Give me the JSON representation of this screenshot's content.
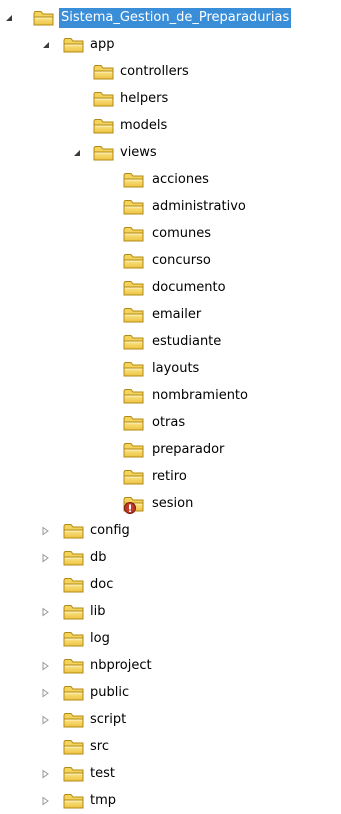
{
  "tree": {
    "root": {
      "label": "Sistema_Gestion_de_Preparadurias",
      "expanded": true,
      "selected": true
    },
    "app": {
      "label": "app",
      "expanded": true,
      "children": [
        "controllers",
        "helpers",
        "models"
      ],
      "views": {
        "label": "views",
        "expanded": true,
        "children": [
          "acciones",
          "administrativo",
          "comunes",
          "concurso",
          "documento",
          "emailer",
          "estudiante",
          "layouts",
          "nombramiento",
          "otras",
          "preparador",
          "retiro"
        ],
        "sesion": {
          "label": "sesion",
          "badge": "error"
        }
      }
    },
    "top_level": [
      {
        "label": "config",
        "expandable": true
      },
      {
        "label": "db",
        "expandable": true
      },
      {
        "label": "doc",
        "expandable": false
      },
      {
        "label": "lib",
        "expandable": true
      },
      {
        "label": "log",
        "expandable": false
      },
      {
        "label": "nbproject",
        "expandable": true
      },
      {
        "label": "public",
        "expandable": true
      },
      {
        "label": "script",
        "expandable": true
      },
      {
        "label": "src",
        "expandable": false
      },
      {
        "label": "test",
        "expandable": true
      },
      {
        "label": "tmp",
        "expandable": true
      }
    ]
  },
  "colors": {
    "selection": "#3a8ed8",
    "folder_fill": "#f3d35a",
    "folder_edge": "#b38a16",
    "arrow_expanded": "#3c3c3c",
    "arrow_collapsed": "#9a9a9a",
    "error_badge": "#c0392b"
  }
}
